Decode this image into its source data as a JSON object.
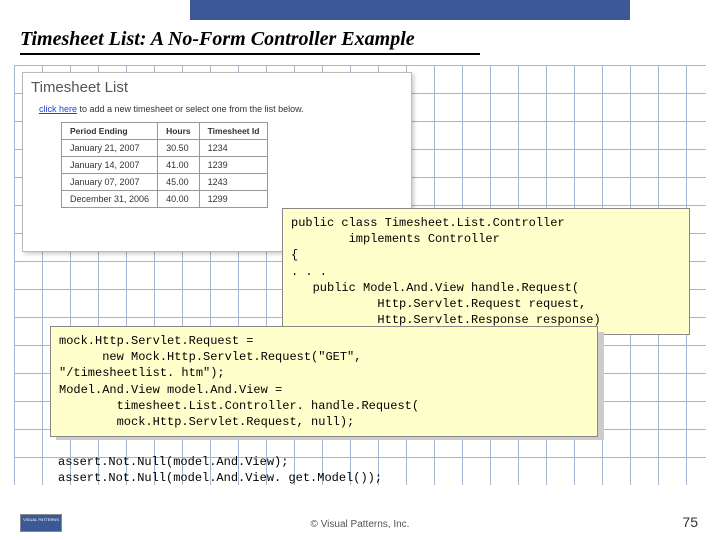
{
  "slide": {
    "title": "Timesheet List: A No-Form Controller Example"
  },
  "screenshot": {
    "heading": "Timesheet List",
    "subtext_prefix": "click here",
    "subtext_rest": " to add a new timesheet or select one from the list below.",
    "columns": {
      "c1": "Period Ending",
      "c2": "Hours",
      "c3": "Timesheet Id"
    },
    "rows": [
      {
        "c1": "January 21, 2007",
        "c2": "30.50",
        "c3": "1234"
      },
      {
        "c1": "January 14, 2007",
        "c2": "41.00",
        "c3": "1239"
      },
      {
        "c1": "January 07, 2007",
        "c2": "45.00",
        "c3": "1243"
      },
      {
        "c1": "December 31, 2006",
        "c2": "40.00",
        "c3": "1299"
      }
    ]
  },
  "code1": "public class Timesheet.List.Controller\n        implements Controller\n{\n. . .\n   public Model.And.View handle.Request(\n            Http.Servlet.Request request,\n            Http.Servlet.Response response)",
  "code2": "mock.Http.Servlet.Request =\n      new Mock.Http.Servlet.Request(\"GET\",\n\"/timesheetlist. htm\");\nModel.And.View model.And.View =\n        timesheet.List.Controller. handle.Request(\n        mock.Http.Servlet.Request, null);",
  "code3": "assert.Not.Null(model.And.View);\nassert.Not.Null(model.And.View. get.Model());",
  "footer": {
    "copyright": "© Visual Patterns, Inc.",
    "page": "75",
    "logo": "VISUAL PATTERNS"
  }
}
